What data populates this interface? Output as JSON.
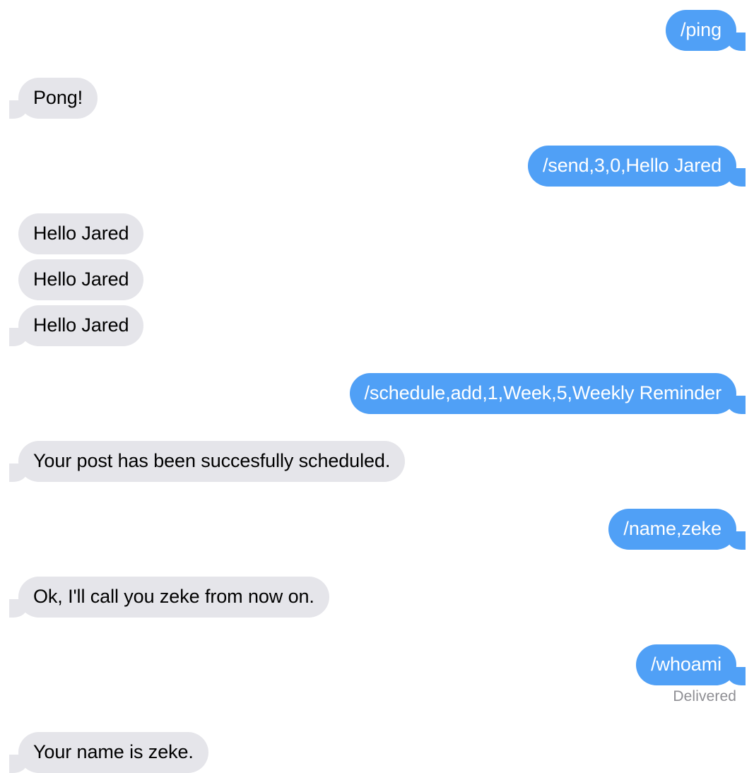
{
  "conversation": {
    "app_style": "imessage",
    "colors": {
      "outgoing_bubble": "#50a0f6",
      "incoming_bubble": "#e5e5ea",
      "outgoing_text": "#ffffff",
      "incoming_text": "#000000",
      "status_text": "#8e8e93",
      "background": "#ffffff"
    },
    "messages": [
      {
        "id": "m1",
        "side": "outgoing",
        "text": "/ping",
        "tail": true,
        "group_start": true
      },
      {
        "id": "m2",
        "side": "incoming",
        "text": "Pong!",
        "tail": true,
        "group_start": true
      },
      {
        "id": "m3",
        "side": "outgoing",
        "text": "/send,3,0,Hello Jared",
        "tail": true,
        "group_start": true
      },
      {
        "id": "m4",
        "side": "incoming",
        "text": "Hello Jared",
        "tail": false,
        "group_start": true
      },
      {
        "id": "m5",
        "side": "incoming",
        "text": "Hello Jared",
        "tail": false,
        "group_start": false
      },
      {
        "id": "m6",
        "side": "incoming",
        "text": "Hello Jared",
        "tail": true,
        "group_start": false
      },
      {
        "id": "m7",
        "side": "outgoing",
        "text": "/schedule,add,1,Week,5,Weekly Reminder",
        "tail": true,
        "group_start": true
      },
      {
        "id": "m8",
        "side": "incoming",
        "text": "Your post has been succesfully scheduled.",
        "tail": true,
        "group_start": true
      },
      {
        "id": "m9",
        "side": "outgoing",
        "text": "/name,zeke",
        "tail": true,
        "group_start": true
      },
      {
        "id": "m10",
        "side": "incoming",
        "text": "Ok, I'll call you zeke from now on.",
        "tail": true,
        "group_start": true
      },
      {
        "id": "m11",
        "side": "outgoing",
        "text": "/whoami",
        "tail": true,
        "group_start": true
      },
      {
        "id": "m12",
        "side": "incoming",
        "text": "Your name is zeke.",
        "tail": true,
        "group_start": true
      }
    ],
    "delivery_status": {
      "label": "Delivered",
      "after_message_id": "m11"
    }
  }
}
